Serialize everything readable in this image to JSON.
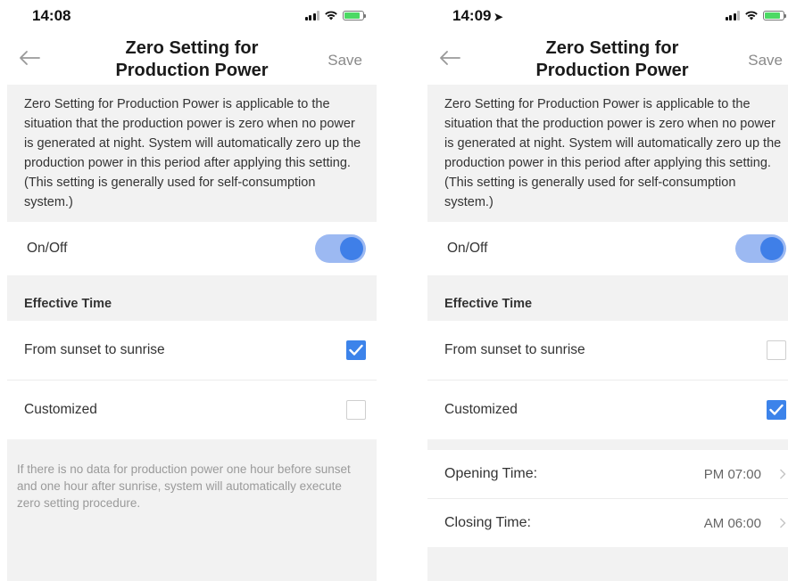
{
  "left": {
    "status": {
      "time": "14:08"
    },
    "nav": {
      "title": "Zero Setting for Production Power",
      "save": "Save"
    },
    "intro": "Zero Setting for Production Power is applicable to the situation that the production power is zero when no power is generated at night. System will automatically zero up the production power in this period after applying this setting. (This setting is generally used for self-consumption system.)",
    "toggle": {
      "label": "On/Off",
      "on": true
    },
    "effective_time": {
      "header": "Effective Time",
      "options": [
        {
          "label": "From sunset to sunrise",
          "checked": true
        },
        {
          "label": "Customized",
          "checked": false
        }
      ]
    },
    "note": "If there is no data for production power one hour before sunset and one hour after sunrise, system will automatically execute zero setting procedure."
  },
  "right": {
    "status": {
      "time": "14:09"
    },
    "nav": {
      "title": "Zero Setting for Production Power",
      "save": "Save"
    },
    "intro": "Zero Setting for Production Power is applicable to the situation that the production power is zero when no power is generated at night. System will automatically zero up the production power in this period after applying this setting. (This setting is generally used for self-consumption system.)",
    "toggle": {
      "label": "On/Off",
      "on": true
    },
    "effective_time": {
      "header": "Effective Time",
      "options": [
        {
          "label": "From sunset to sunrise",
          "checked": false
        },
        {
          "label": "Customized",
          "checked": true
        }
      ]
    },
    "opening": {
      "label": "Opening Time:",
      "value": "PM 07:00"
    },
    "closing": {
      "label": "Closing Time:",
      "value": "AM 06:00"
    }
  },
  "colors": {
    "accent": "#3c83ea",
    "toggle_track": "#9cb9f2",
    "toggle_knob": "#3f7fe8",
    "background_gray": "#f2f2f2"
  }
}
